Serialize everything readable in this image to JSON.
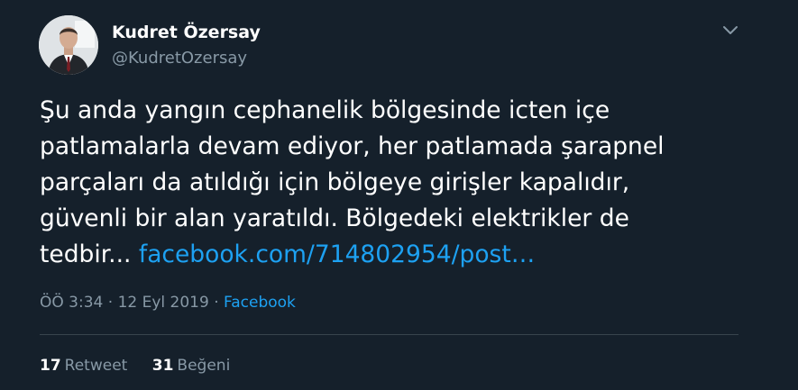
{
  "author": {
    "display_name": "Kudret Özersay",
    "handle": "@KudretOzersay"
  },
  "tweet": {
    "text_lines": [
      "Şu anda yangın cephanelik bölgesinde icten içe",
      "patlamalarla devam ediyor, her patlamada şarapnel",
      "parçaları da atıldığı için bölgeye girişler kapalıdır,",
      "güvenli bir alan yaratıldı. Bölgedeki elektrikler de"
    ],
    "last_line_text": "tedbir... ",
    "link_text": "facebook.com/714802954/post…"
  },
  "meta": {
    "time": "ÖÖ 3:34",
    "date": "12 Eyl 2019",
    "separator": "·",
    "source": "Facebook"
  },
  "stats": {
    "retweets": "17",
    "retweet_label": "Retweet",
    "likes": "31",
    "like_label": "Beğeni"
  },
  "icons": {
    "menu": "chevron-down-icon",
    "avatar": "avatar"
  },
  "colors": {
    "background": "#15202b",
    "text": "#ffffff",
    "secondary": "#8899a6",
    "link": "#1da1f2",
    "divider": "#38444d"
  }
}
